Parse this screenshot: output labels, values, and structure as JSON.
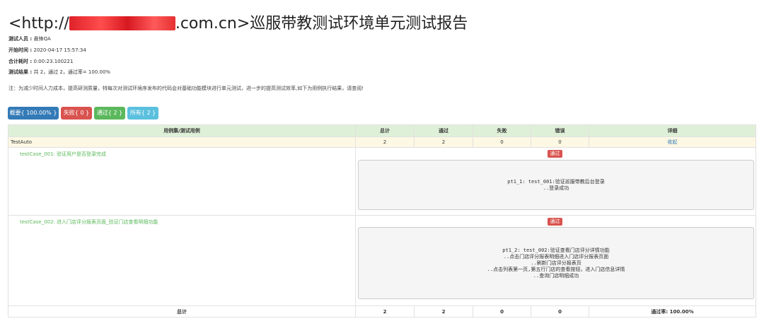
{
  "header": {
    "title_prefix": "<http://",
    "title_domain_visible": ".com.cn>巡服带教测试环境单元测试报告"
  },
  "info": {
    "tester_label": "测试人员 :",
    "tester_value": "悬锋QA",
    "start_label": "开始时间 :",
    "start_value": "2020-04-17 15:57:34",
    "duration_label": "合计耗时 :",
    "duration_value": "0:00:23.100221",
    "result_label": "测试结果 :",
    "result_value": "共 2，通过 2，通过率= 100.00%"
  },
  "note": "注：为减少时间人力成本，提高研测质量，特每次对测试环境序发布的代码会对基础功能模块进行单元测试，进一步的提高测试效率,如下为用例执行结果，请查阅!",
  "filters": {
    "summary": "概要{ 100.00% }",
    "fail": "失败{ 0 }",
    "pass": "通过{ 2 }",
    "all": "所有{ 2 }"
  },
  "table": {
    "headers": [
      "用例集/测试用例",
      "总计",
      "通过",
      "失败",
      "错误",
      "详细"
    ],
    "suite": {
      "name": "TestAuto",
      "total": "2",
      "pass": "2",
      "fail": "0",
      "error": "0",
      "detail": "收起"
    },
    "cases": [
      {
        "name": "testCase_001: 验证用户是否登录完成",
        "status": "通过",
        "log": [
          "pt1_1: test_001:验证巡服带教后台登录",
          "..登录成功"
        ]
      },
      {
        "name": "testCase_002: 进入门店评分报表页面_验证门店查看明细功能",
        "status": "通过",
        "log": [
          "pt1_2: test_002:验证查看门店评分详情功能",
          "..点击门店评分报表明细进入门店评分报表页面",
          "..刷新门店评分报表页",
          "..点击列表第一页,第五行门店的查看按钮，进入门店信息详情",
          "..查询门店明细成功"
        ]
      }
    ],
    "footer": {
      "label": "总计",
      "total": "2",
      "pass": "2",
      "fail": "0",
      "error": "0",
      "rate": "通过率: 100.00%"
    }
  }
}
